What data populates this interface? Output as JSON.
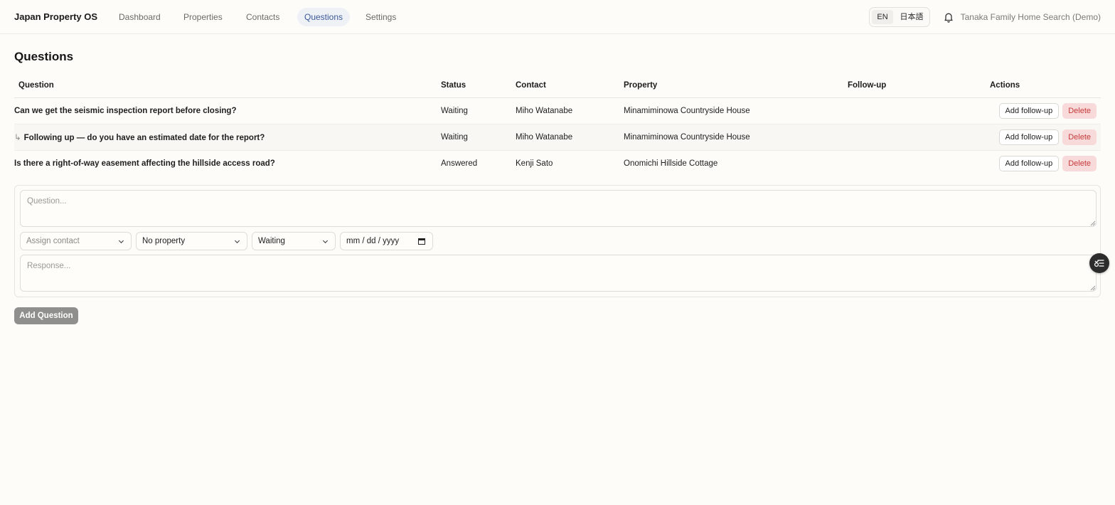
{
  "app": {
    "title": "Japan Property OS"
  },
  "nav": {
    "items": [
      {
        "label": "Dashboard"
      },
      {
        "label": "Properties"
      },
      {
        "label": "Contacts"
      },
      {
        "label": "Questions"
      },
      {
        "label": "Settings"
      }
    ],
    "active": "Questions"
  },
  "language": {
    "en": "EN",
    "ja": "日本語",
    "selected": "EN"
  },
  "account": {
    "name": "Tanaka Family Home Search (Demo)"
  },
  "page": {
    "title": "Questions"
  },
  "table": {
    "headers": {
      "question": "Question",
      "status": "Status",
      "contact": "Contact",
      "property": "Property",
      "followup": "Follow-up",
      "actions": "Actions"
    },
    "rows": [
      {
        "question": "Can we get the seismic inspection report before closing?",
        "status": "Waiting",
        "contact": "Miho Watanabe",
        "property": "Minamiminowa Countryside House",
        "followup": "",
        "is_followup": false
      },
      {
        "arrow": "↳",
        "question": "Following up — do you have an estimated date for the report?",
        "status": "Waiting",
        "contact": "Miho Watanabe",
        "property": "Minamiminowa Countryside House",
        "followup": "",
        "is_followup": true
      },
      {
        "question": "Is there a right-of-way easement affecting the hillside access road?",
        "status": "Answered",
        "contact": "Kenji Sato",
        "property": "Onomichi Hillside Cottage",
        "followup": "",
        "is_followup": false
      }
    ],
    "actions": {
      "add_followup": "Add follow-up",
      "delete": "Delete"
    }
  },
  "form": {
    "question_placeholder": "Question...",
    "contact_select": "Assign contact",
    "property_select": "No property",
    "status_select": "Waiting",
    "date_placeholder": "mm / dd / yyyy",
    "response_placeholder": "Response...",
    "submit_label": "Add Question"
  },
  "colors": {
    "background": "#fdfcf8",
    "active_nav_bg": "#eef1f6",
    "active_nav_text": "#3d5a9a",
    "delete_bg": "#f8dada",
    "delete_text": "#c63a3a",
    "submit_bg": "#8f8f8d"
  },
  "icons": [
    "bell-icon",
    "chevron-down-icon",
    "calendar-icon",
    "resize-handle-icon",
    "feedback-icon"
  ]
}
